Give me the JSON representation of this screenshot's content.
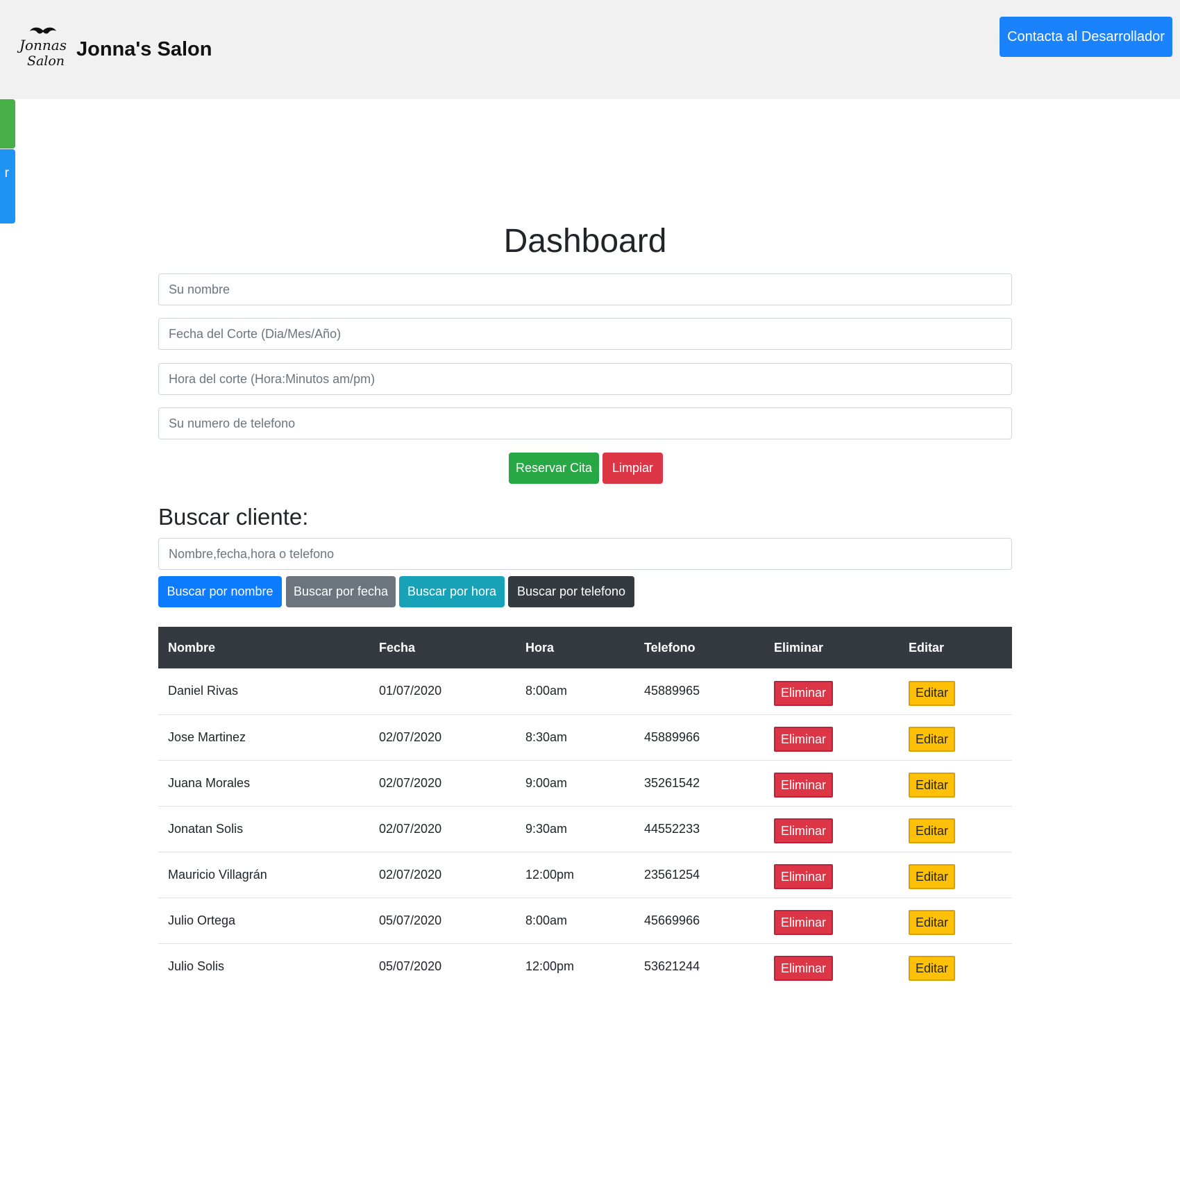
{
  "header": {
    "brand_name": "Jonna's Salon",
    "logo_text_top": "Jonnas",
    "logo_text_bottom": "Salon",
    "contact_label": "Contacta al Desarrollador"
  },
  "side_tabs": {
    "blue_label": "r"
  },
  "main": {
    "title": "Dashboard",
    "form": {
      "name_placeholder": "Su nombre",
      "date_placeholder": "Fecha del Corte (Dia/Mes/Año)",
      "time_placeholder": "Hora del corte (Hora:Minutos am/pm)",
      "phone_placeholder": "Su numero de telefono",
      "reserve_label": "Reservar Cita",
      "clear_label": "Limpiar"
    },
    "search": {
      "heading": "Buscar cliente:",
      "placeholder": "Nombre,fecha,hora o telefono",
      "by_name": "Buscar por nombre",
      "by_date": "Buscar por fecha",
      "by_time": "Buscar por hora",
      "by_phone": "Buscar por telefono"
    },
    "table": {
      "headers": [
        "Nombre",
        "Fecha",
        "Hora",
        "Telefono",
        "Eliminar",
        "Editar"
      ],
      "delete_label": "Eliminar",
      "edit_label": "Editar",
      "rows": [
        {
          "nombre": "Daniel Rivas",
          "fecha": "01/07/2020",
          "hora": "8:00am",
          "telefono": "45889965"
        },
        {
          "nombre": "Jose Martinez",
          "fecha": "02/07/2020",
          "hora": "8:30am",
          "telefono": "45889966"
        },
        {
          "nombre": "Juana Morales",
          "fecha": "02/07/2020",
          "hora": "9:00am",
          "telefono": "35261542"
        },
        {
          "nombre": "Jonatan Solis",
          "fecha": "02/07/2020",
          "hora": "9:30am",
          "telefono": "44552233"
        },
        {
          "nombre": "Mauricio Villagrán",
          "fecha": "02/07/2020",
          "hora": "12:00pm",
          "telefono": "23561254"
        },
        {
          "nombre": "Julio Ortega",
          "fecha": "05/07/2020",
          "hora": "8:00am",
          "telefono": "45669966"
        },
        {
          "nombre": "Julio Solis",
          "fecha": "05/07/2020",
          "hora": "12:00pm",
          "telefono": "53621244"
        }
      ]
    }
  },
  "colors": {
    "primary": "#0d7bfd",
    "success": "#28a745",
    "danger": "#dc3545",
    "warning": "#ffc107",
    "info": "#17a2b8",
    "dark": "#343a40",
    "secondary": "#6c757d"
  }
}
